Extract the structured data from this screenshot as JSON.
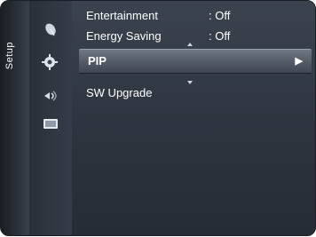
{
  "sidebar": {
    "label": "Setup",
    "icons": [
      {
        "name": "satellite-dish-icon"
      },
      {
        "name": "gear-icon"
      },
      {
        "name": "pip-sound-icon"
      },
      {
        "name": "screen-input-icon"
      }
    ]
  },
  "menu": {
    "items": [
      {
        "label": "Entertainment",
        "value": ": Off"
      },
      {
        "label": "Energy Saving",
        "value": ": Off"
      },
      {
        "label": "PIP",
        "value": "",
        "arrow": "▶"
      },
      {
        "label": "SW Upgrade",
        "value": ""
      }
    ]
  }
}
